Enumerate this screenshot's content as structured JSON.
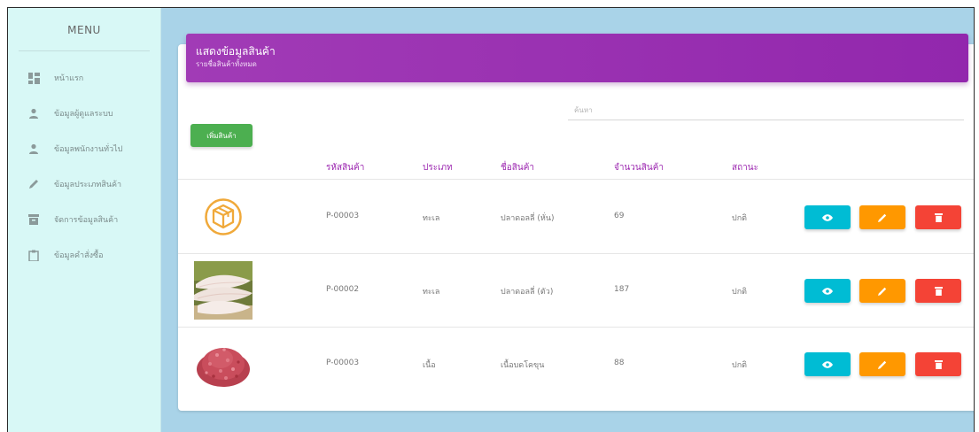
{
  "sidebar": {
    "title": "MENU",
    "items": [
      {
        "label": "หน้าแรก",
        "icon": "dashboard-icon"
      },
      {
        "label": "ข้อมูลผู้ดูแลระบบ",
        "icon": "person-icon"
      },
      {
        "label": "ข้อมูลพนักงานทั่วไป",
        "icon": "person-icon"
      },
      {
        "label": "ข้อมูลประเภทสินค้า",
        "icon": "pencil-icon"
      },
      {
        "label": "จัดการข้อมูลสินค้า",
        "icon": "archive-icon"
      },
      {
        "label": "ข้อมูลคำสั่งซื้อ",
        "icon": "clipboard-icon"
      }
    ]
  },
  "header": {
    "title": "แสดงข้อมูลสินค้า",
    "subtitle": "รายชื่อสินค้าทั้งหมด"
  },
  "search": {
    "placeholder": "ค้นหา",
    "value": ""
  },
  "toolbar": {
    "add_label": "เพิ่มสินค้า"
  },
  "table": {
    "columns": [
      "รหัสสินค้า",
      "ประเภท",
      "ชื่อสินค้า",
      "จำนวนสินค้า",
      "สถานะ"
    ],
    "rows": [
      {
        "code": "P-00003",
        "type": "ทะเล",
        "name": "ปลาดอลลี่ (หั่น)",
        "qty": "69",
        "status": "ปกติ",
        "thumb": "box-icon"
      },
      {
        "code": "P-00002",
        "type": "ทะเล",
        "name": "ปลาดอลลี่ (ตัว)",
        "qty": "187",
        "status": "ปกติ",
        "thumb": "fish-fillet-photo"
      },
      {
        "code": "P-00003",
        "type": "เนื้อ",
        "name": "เนื้อบดโคขุน",
        "qty": "88",
        "status": "ปกติ",
        "thumb": "ground-beef-photo"
      }
    ]
  },
  "colors": {
    "header": "#9c27b0",
    "add": "#4caf50",
    "view": "#00bcd4",
    "edit": "#ff9800",
    "delete": "#f44336",
    "sidebar_bg": "#d8f8f6",
    "page_bg": "#a9d3e8"
  }
}
